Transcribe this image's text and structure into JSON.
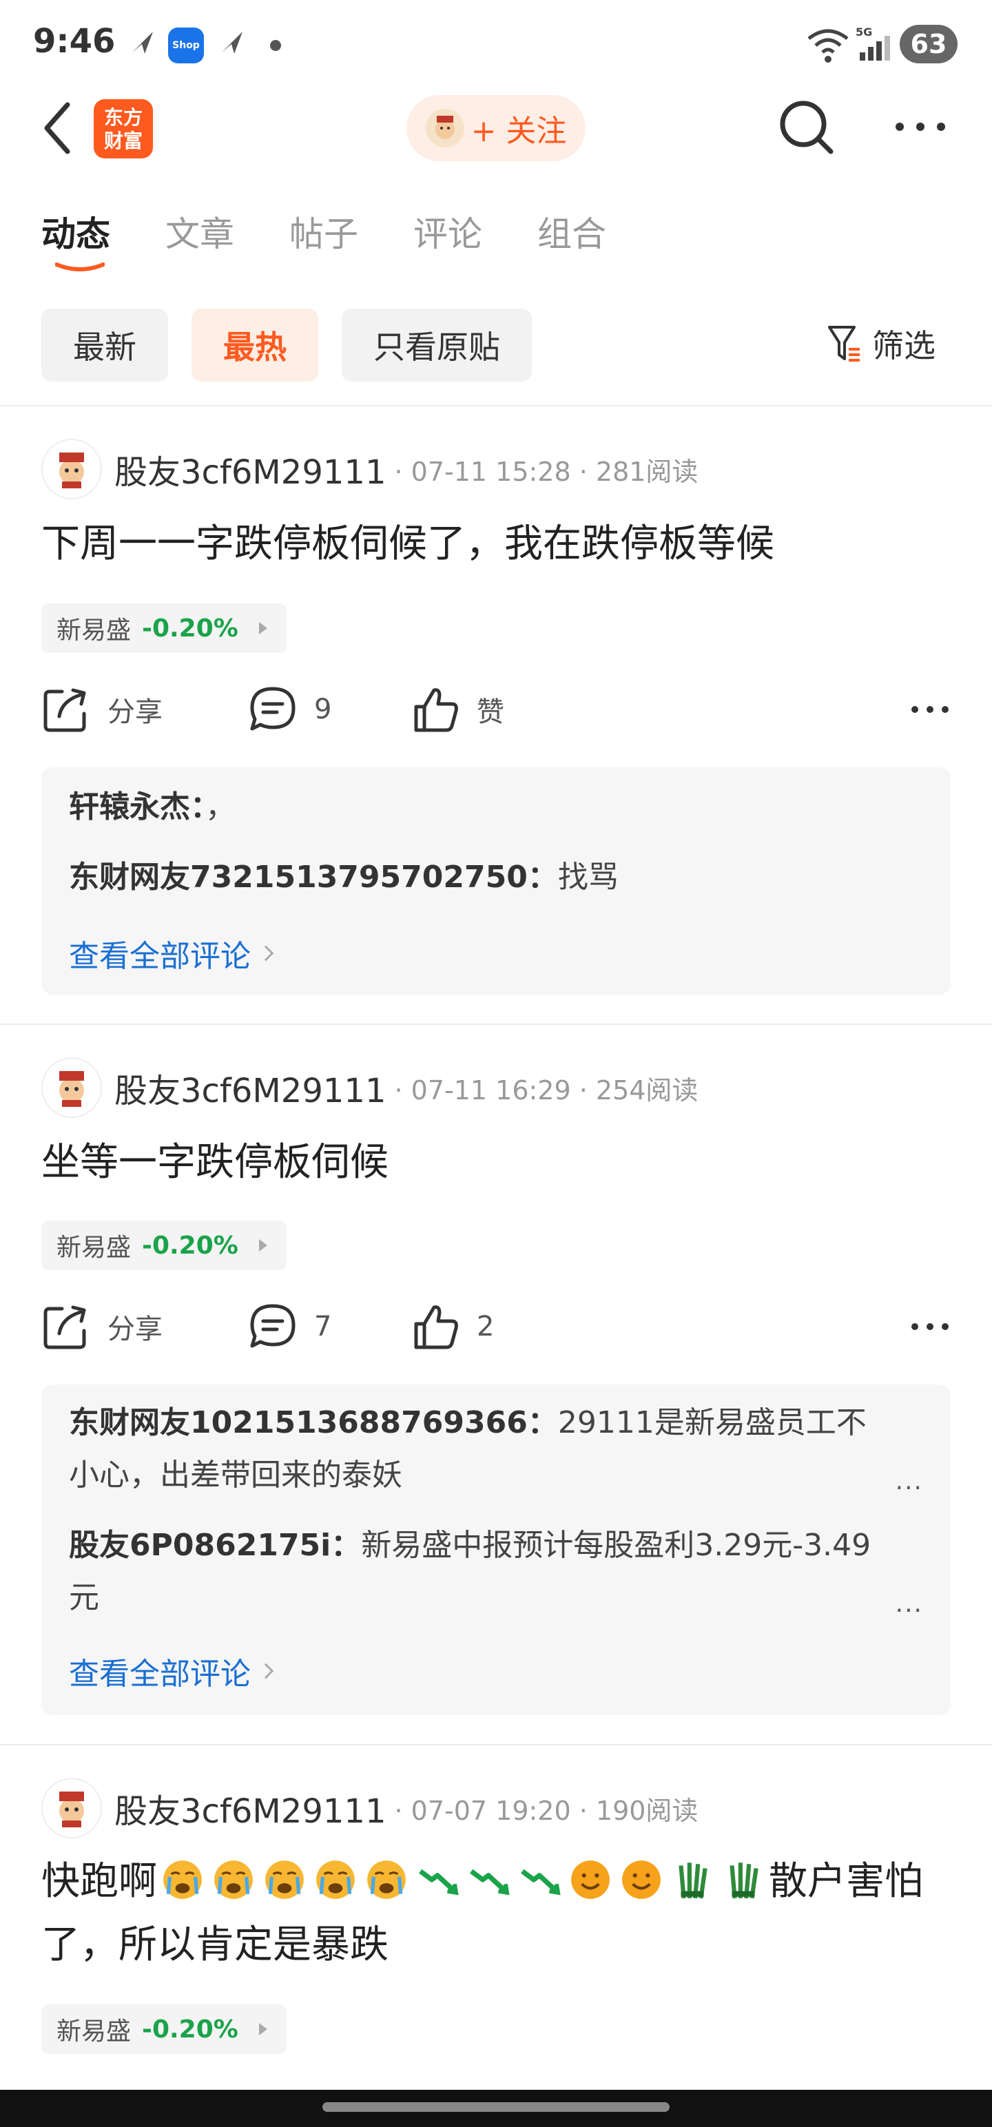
{
  "status_bar": {
    "time": "9:46",
    "shop_label": "Shop",
    "network": "5G",
    "battery": "63",
    "icons": [
      "send-icon",
      "shop-icon",
      "send-icon",
      "dot-icon",
      "wifi-icon",
      "signal-icon",
      "battery-icon"
    ]
  },
  "nav": {
    "logo_line1": "东方",
    "logo_line2": "财富",
    "follow_label": "+ 关注"
  },
  "tabs": [
    {
      "label": "动态",
      "active": true
    },
    {
      "label": "文章",
      "active": false
    },
    {
      "label": "帖子",
      "active": false
    },
    {
      "label": "评论",
      "active": false
    },
    {
      "label": "组合",
      "active": false
    }
  ],
  "filters": {
    "items": [
      "最新",
      "最热",
      "只看原贴"
    ],
    "active": "最热",
    "filter_label": "筛选"
  },
  "accent_color": "#ff5a1f",
  "link_color": "#1b6fd1",
  "down_color": "#1aa34a",
  "actions": {
    "share": "分享",
    "like": "赞"
  },
  "posts": [
    {
      "author": "股友3cf6M29111",
      "meta": "· 07-11 15:28 · 281阅读",
      "text": "下周一一字跌停板伺候了，我在跌停板等候",
      "stock_name": "新易盛",
      "stock_change": "-0.20%",
      "comment_count": "9",
      "like_label": "赞",
      "comments": [
        {
          "user": "轩辕永杰",
          "sep": "：",
          "text": "，"
        },
        {
          "user": "东财网友7321513795702750",
          "sep": "：",
          "text": "找骂"
        }
      ],
      "view_all": "查看全部评论"
    },
    {
      "author": "股友3cf6M29111",
      "meta": "· 07-11 16:29 · 254阅读",
      "text": "坐等一字跌停板伺候",
      "stock_name": "新易盛",
      "stock_change": "-0.20%",
      "comment_count": "7",
      "like_label": "2",
      "comments": [
        {
          "user": "东财网友1021513688769366",
          "sep": "：",
          "text": "29111是新易盛员工不小心，出差带回来的泰妖"
        },
        {
          "user": "股友6P0862175i",
          "sep": "：",
          "text": "新易盛中报预计每股盈利3.29元-3.49元"
        }
      ],
      "ellipsis": "...",
      "view_all": "查看全部评论"
    },
    {
      "author": "股友3cf6M29111",
      "meta": "· 07-07 19:20 · 190阅读",
      "text_prefix": "快跑啊",
      "text_suffix": "散户害怕了，所以肯定是暴跌",
      "emojis": [
        "crying-face",
        "crying-face",
        "crying-face",
        "crying-face",
        "crying-face",
        "chart-decreasing",
        "chart-decreasing",
        "chart-decreasing",
        "smiling-face",
        "smiling-face",
        "leafy-greens",
        "leafy-greens"
      ],
      "stock_name": "新易盛",
      "stock_change": "-0.20%"
    }
  ]
}
